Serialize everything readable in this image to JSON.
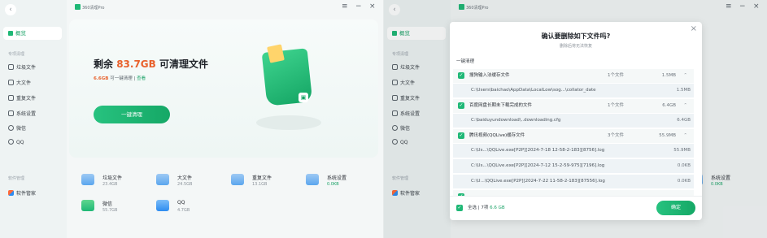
{
  "app": {
    "title": "360清理Pro"
  },
  "sidebar": {
    "home": "概览",
    "section1": "专项清理",
    "items": [
      "垃圾文件",
      "大文件",
      "重复文件",
      "系统设置",
      "微信",
      "QQ"
    ],
    "section2": "软件管理",
    "app_manager": "软件管家"
  },
  "main": {
    "headline_prefix": "剩余",
    "headline_size": "83.7GB",
    "headline_suffix": "可清理文件",
    "sub_size": "6.6GB",
    "sub_text": "可一键清理",
    "sub_sep": "|",
    "sub_link": "查看",
    "clean_button": "一键清理"
  },
  "categories": [
    {
      "name": "垃圾文件",
      "size": "23.4GB"
    },
    {
      "name": "大文件",
      "size": "24.5GB"
    },
    {
      "name": "重复文件",
      "size": "13.1GB"
    },
    {
      "name": "系统设置",
      "size": "0.0KB"
    },
    {
      "name": "微信",
      "size": "55.7GB"
    },
    {
      "name": "QQ",
      "size": "4.7GB"
    }
  ],
  "dialog": {
    "title": "确认要删除如下文件吗?",
    "subtitle": "删除后将无法恢复",
    "section": "一键清理",
    "groups": [
      {
        "name": "搜狗输入法缓存文件",
        "count": "1个文件",
        "size": "1.5MB",
        "paths": [
          {
            "path": "C:\\Users\\baichao\\AppData\\LocalLow\\sog...\\collator_date",
            "size": "1.5MB"
          }
        ]
      },
      {
        "name": "百度网盘长期未下载完成的文件",
        "count": "1个文件",
        "size": "6.4GB",
        "paths": [
          {
            "path": "C:\\baiduyundownload\\..downloading.cfg",
            "size": "6.4GB"
          }
        ]
      },
      {
        "name": "腾讯视频(QQLive)缓存文件",
        "count": "3个文件",
        "size": "55.9MB",
        "paths": [
          {
            "path": "C:\\Us...\\QQLive.exe[P2P][2024-7-18 12-58-2-183][8756].log",
            "size": "55.9MB"
          },
          {
            "path": "C:\\Us...\\QQLive.exe[P2P][2024-7-12 15-2-59-975][7196].log",
            "size": "0.0KB"
          },
          {
            "path": "C:\\U...\\QQLive.exe[P2P][2024-7-22 11-58-2-183][87556].log",
            "size": "0.0KB"
          }
        ]
      }
    ],
    "footer_all": "全选",
    "footer_sep": "|",
    "footer_count": "7项",
    "footer_size": "6.6 GB",
    "confirm": "确定"
  },
  "controls": {
    "menu": "≡",
    "min": "−",
    "close": "×",
    "back": "‹",
    "dlg_close": "×"
  }
}
